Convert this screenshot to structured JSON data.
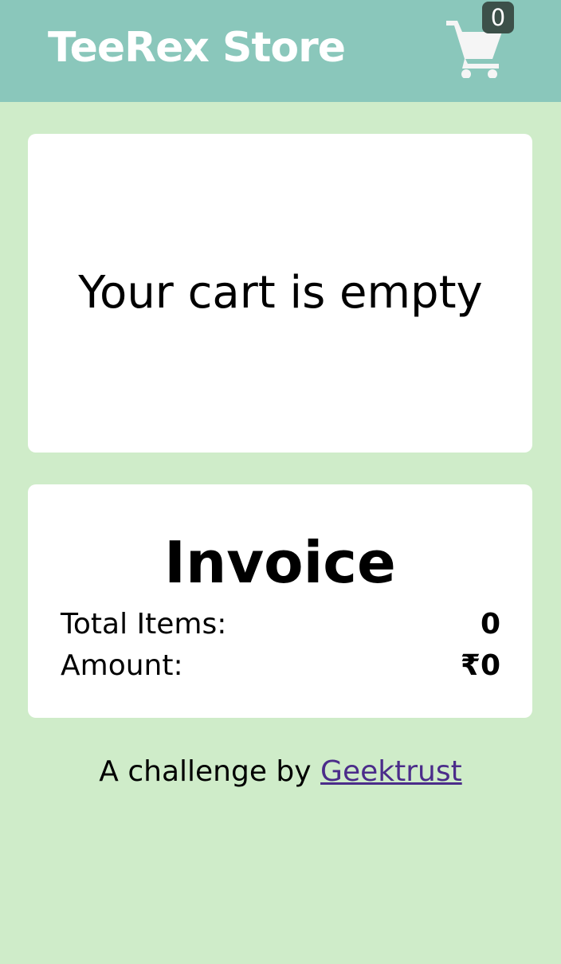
{
  "header": {
    "brand": "TeeRex Store",
    "cart_icon": "shopping-cart-icon",
    "cart_count": "0"
  },
  "cart": {
    "empty_message": "Your cart is empty"
  },
  "invoice": {
    "title": "Invoice",
    "total_items_label": "Total Items:",
    "total_items_value": "0",
    "amount_label": "Amount:",
    "amount_value": "₹0"
  },
  "footer": {
    "prefix": "A challenge by ",
    "link_text": "Geektrust"
  },
  "colors": {
    "page_bg": "#cfecc9",
    "header_bg": "#8ac7bb",
    "badge_bg": "#3c5049",
    "card_bg": "#ffffff",
    "link": "#4b2c8a"
  }
}
